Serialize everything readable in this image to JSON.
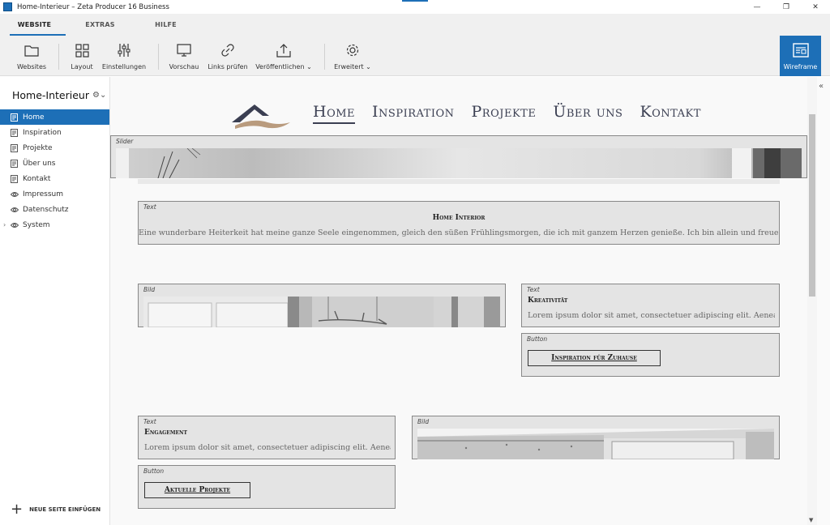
{
  "window": {
    "title": "Home-Interieur – Zeta Producer 16 Business",
    "controls": [
      "—",
      "❐",
      "✕"
    ]
  },
  "tabs": [
    {
      "label": "WEBSITE",
      "active": true
    },
    {
      "label": "EXTRAS",
      "active": false
    },
    {
      "label": "HILFE",
      "active": false
    }
  ],
  "toolbar": {
    "websites": "Websites",
    "layout": "Layout",
    "einstellungen": "Einstellungen",
    "vorschau": "Vorschau",
    "links": "Links prüfen",
    "veroeffentlichen": "Veröffentlichen",
    "erweitert": "Erweitert",
    "wireframe": "Wireframe"
  },
  "sidebar": {
    "site_title": "Home-Interieur",
    "items": [
      {
        "label": "Home",
        "icon": "page-icon",
        "active": true
      },
      {
        "label": "Inspiration",
        "icon": "page-icon"
      },
      {
        "label": "Projekte",
        "icon": "page-icon"
      },
      {
        "label": "Über uns",
        "icon": "page-icon"
      },
      {
        "label": "Kontakt",
        "icon": "page-icon"
      },
      {
        "label": "Impressum",
        "icon": "eye-icon"
      },
      {
        "label": "Datenschutz",
        "icon": "eye-icon"
      },
      {
        "label": "System",
        "icon": "eye-icon",
        "expandable": true
      }
    ],
    "add_page": "NEUE SEITE EINFÜGEN"
  },
  "site": {
    "nav": [
      "Home",
      "Inspiration",
      "Projekte",
      "Über uns",
      "Kontakt"
    ],
    "active_nav": "Home"
  },
  "blocks": {
    "slider": {
      "tag": "Slider"
    },
    "text1": {
      "tag": "Text",
      "heading": "Home Interior",
      "body": "Eine wunderbare Heiterkeit hat meine ganze Seele eingenommen, gleich den süßen Frühlingsmorgen, die ich mit ganzem Herzen genieße. Ich bin allein und freue mich"
    },
    "image1": {
      "tag": "Bild"
    },
    "text2": {
      "tag": "Text",
      "heading": "Kreativität",
      "body": "Lorem ipsum dolor sit amet, consectetuer adipiscing elit. Aenean"
    },
    "button1": {
      "tag": "Button",
      "label": "Inspiration für Zuhause"
    },
    "text3": {
      "tag": "Text",
      "heading": "Engagement",
      "body": "Lorem ipsum dolor sit amet, consectetuer adipiscing elit. Aenean"
    },
    "button2": {
      "tag": "Button",
      "label": "Aktuelle Projekte"
    },
    "image2": {
      "tag": "Bild"
    }
  },
  "colors": {
    "accent": "#1d6fb7",
    "nav_text": "#3b3f52",
    "logo_dark": "#3b3f52",
    "logo_light": "#b99b7e"
  }
}
